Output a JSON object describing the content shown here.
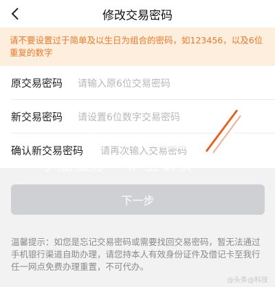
{
  "header": {
    "title": "修改交易密码",
    "back_icon": "chevron-left-icon"
  },
  "notice": {
    "text": "请不要设置过于简单及以生日为组合的密码，如123456，以及6位重复的数字"
  },
  "form": {
    "rows": [
      {
        "label": "原交易密码",
        "placeholder": "请输入原6位交易密码"
      },
      {
        "label": "新交易密码",
        "placeholder": "请设置6位数字交易密码"
      },
      {
        "label": "确认新交易密码",
        "placeholder": "请再次输入交易密码"
      }
    ]
  },
  "submit": {
    "label": "下一步"
  },
  "tips": {
    "text": "温馨提示：如您是忘记交易密码或需要找回交易密码，暂无法通过手机银行渠道自助办理，请您持本人有效身份证件及借记卡至我行任一网点免费办理重置，不可代办。"
  },
  "overlay": {
    "text": "手能值办 · 炉生钢痰"
  },
  "watermark": {
    "text": "@头条@科技"
  },
  "colors": {
    "accent": "#f07828",
    "notice_bg": "#fdeede",
    "button_disabled": "#cfd0d4"
  }
}
